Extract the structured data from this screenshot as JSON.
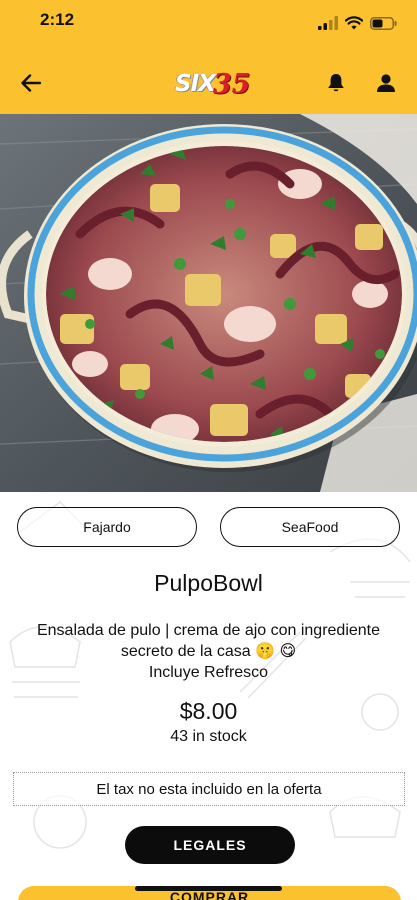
{
  "status_bar": {
    "time": "2:12"
  },
  "header": {
    "logo_six": "SIX",
    "logo_num": "35"
  },
  "product": {
    "tags": [
      "Fajardo",
      "SeaFood"
    ],
    "name": "PulpoBowl",
    "description_line1": "Ensalada de pulo | crema de ajo con ingrediente",
    "description_line2": "secreto de la casa 🤫 😋",
    "description_line3": "Incluye Refresco",
    "price": "$8.00",
    "stock": "43 in stock",
    "tax_note": "El tax no esta incluido en la oferta"
  },
  "actions": {
    "legales_label": "LEGALES",
    "comprar_label": "COMPRAR"
  },
  "colors": {
    "brand_yellow": "#fbc12e",
    "logo_red": "#d8202a",
    "button_black": "#0c0c0c",
    "bowl_rim_blue": "#4aa3da"
  },
  "icons": [
    "back-arrow-icon",
    "bell-icon",
    "user-icon",
    "signal-icon",
    "wifi-icon",
    "battery-icon"
  ]
}
